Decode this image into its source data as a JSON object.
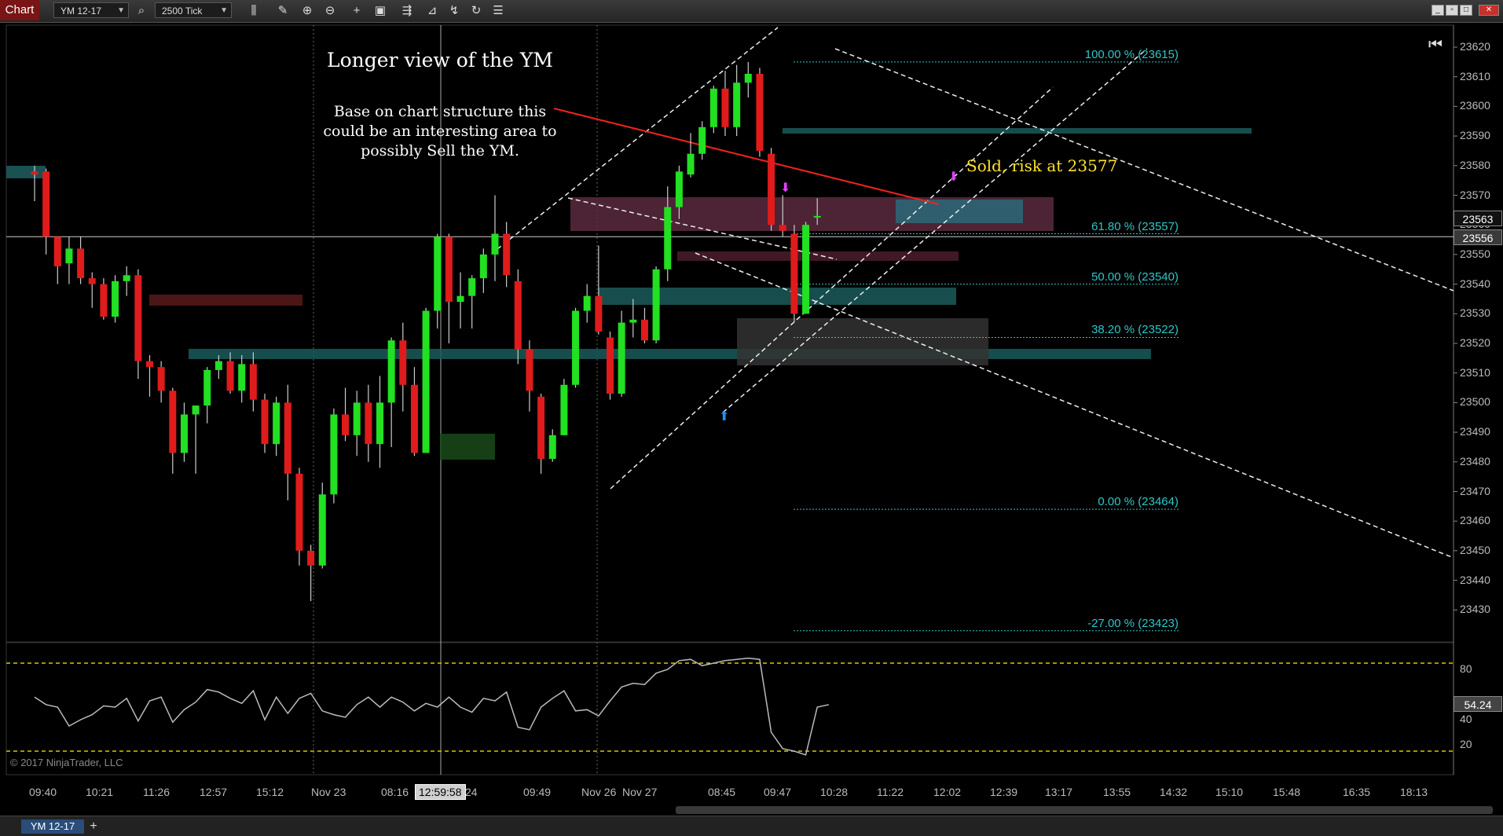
{
  "toolbar": {
    "chart_tab": "Chart",
    "instrument": "YM 12-17",
    "interval": "2500 Tick",
    "icons": [
      "search-icon",
      "bars-icon",
      "pencil-icon",
      "zoom-in-icon",
      "zoom-out-icon",
      "crosshair-icon",
      "data-box-icon",
      "strategy-icon",
      "indicator-icon",
      "drawing-tools-icon",
      "refresh-icon",
      "properties-icon"
    ]
  },
  "annotations": {
    "title": "Longer view of the YM",
    "body_line1": "Base on chart structure this",
    "body_line2": "could be an interesting area to",
    "body_line3": "possibly Sell the YM.",
    "sold": "Sold, risk at 23577"
  },
  "price_axis": {
    "ticks": [
      "23620",
      "23610",
      "23600",
      "23590",
      "23580",
      "23570",
      "23560",
      "23550",
      "23540",
      "23530",
      "23520",
      "23510",
      "23500",
      "23490",
      "23480",
      "23470",
      "23460",
      "23450",
      "23440",
      "23430"
    ],
    "tag_upper": "23563",
    "tag_last": "23556"
  },
  "fib_levels": [
    {
      "label": "100.00 % (23615)",
      "price": 23615
    },
    {
      "label": "61.80 % (23557)",
      "price": 23557
    },
    {
      "label": "50.00 % (23540)",
      "price": 23540
    },
    {
      "label": "38.20 % (23522)",
      "price": 23522
    },
    {
      "label": "0.00 % (23464)",
      "price": 23464
    },
    {
      "label": "-27.00 % (23423)",
      "price": 23423
    }
  ],
  "time_axis": {
    "labels": [
      "09:40",
      "10:21",
      "11:26",
      "12:57",
      "15:12",
      "Nov 23",
      "08:16",
      "24",
      "09:49",
      "Nov 26",
      "Nov 27",
      "08:45",
      "09:47",
      "10:28",
      "11:22",
      "12:02",
      "12:39",
      "13:17",
      "13:55",
      "14:32",
      "15:10",
      "15:48",
      "16:35",
      "18:13"
    ],
    "cursor_time": "12:59:58"
  },
  "indicator": {
    "ticks": [
      "80",
      "40",
      "20"
    ],
    "value_tag": "54.24",
    "upper_band": 85,
    "lower_band": 15
  },
  "copyright": "© 2017 NinjaTrader, LLC",
  "bottom_tab": "YM 12-17",
  "colors": {
    "up": "#22e022",
    "down": "#e01b1b",
    "fib": "#2fc6c6",
    "annotation_yellow": "#ffe22c",
    "band_yellow": "#d8c800"
  },
  "candles": [
    {
      "o": 23578,
      "h": 23580,
      "l": 23568,
      "c": 23577
    },
    {
      "o": 23578,
      "h": 23579,
      "l": 23550,
      "c": 23556
    },
    {
      "o": 23556,
      "h": 23555,
      "l": 23540,
      "c": 23546
    },
    {
      "o": 23547,
      "h": 23556,
      "l": 23540,
      "c": 23552
    },
    {
      "o": 23552,
      "h": 23556,
      "l": 23540,
      "c": 23542
    },
    {
      "o": 23542,
      "h": 23544,
      "l": 23532,
      "c": 23540
    },
    {
      "o": 23540,
      "h": 23542,
      "l": 23528,
      "c": 23529
    },
    {
      "o": 23529,
      "h": 23543,
      "l": 23527,
      "c": 23541
    },
    {
      "o": 23541,
      "h": 23546,
      "l": 23536,
      "c": 23543
    },
    {
      "o": 23543,
      "h": 23545,
      "l": 23508,
      "c": 23514
    },
    {
      "o": 23514,
      "h": 23516,
      "l": 23502,
      "c": 23512
    },
    {
      "o": 23512,
      "h": 23514,
      "l": 23500,
      "c": 23504
    },
    {
      "o": 23504,
      "h": 23505,
      "l": 23476,
      "c": 23483
    },
    {
      "o": 23483,
      "h": 23500,
      "l": 23480,
      "c": 23496
    },
    {
      "o": 23496,
      "h": 23499,
      "l": 23476,
      "c": 23499
    },
    {
      "o": 23499,
      "h": 23512,
      "l": 23493,
      "c": 23511
    },
    {
      "o": 23511,
      "h": 23516,
      "l": 23508,
      "c": 23514
    },
    {
      "o": 23514,
      "h": 23517,
      "l": 23503,
      "c": 23504
    },
    {
      "o": 23504,
      "h": 23516,
      "l": 23500,
      "c": 23513
    },
    {
      "o": 23513,
      "h": 23517,
      "l": 23497,
      "c": 23501
    },
    {
      "o": 23501,
      "h": 23503,
      "l": 23483,
      "c": 23486
    },
    {
      "o": 23486,
      "h": 23502,
      "l": 23482,
      "c": 23500
    },
    {
      "o": 23500,
      "h": 23506,
      "l": 23467,
      "c": 23476
    },
    {
      "o": 23476,
      "h": 23478,
      "l": 23445,
      "c": 23450
    },
    {
      "o": 23450,
      "h": 23452,
      "l": 23433,
      "c": 23445
    },
    {
      "o": 23445,
      "h": 23473,
      "l": 23444,
      "c": 23469
    },
    {
      "o": 23469,
      "h": 23498,
      "l": 23466,
      "c": 23496
    },
    {
      "o": 23496,
      "h": 23505,
      "l": 23487,
      "c": 23489
    },
    {
      "o": 23489,
      "h": 23504,
      "l": 23482,
      "c": 23500
    },
    {
      "o": 23500,
      "h": 23506,
      "l": 23480,
      "c": 23486
    },
    {
      "o": 23486,
      "h": 23509,
      "l": 23478,
      "c": 23500
    },
    {
      "o": 23500,
      "h": 23522,
      "l": 23485,
      "c": 23521
    },
    {
      "o": 23521,
      "h": 23527,
      "l": 23497,
      "c": 23506
    },
    {
      "o": 23506,
      "h": 23512,
      "l": 23482,
      "c": 23483
    },
    {
      "o": 23483,
      "h": 23532,
      "l": 23483,
      "c": 23531
    },
    {
      "o": 23531,
      "h": 23557,
      "l": 23525,
      "c": 23556
    },
    {
      "o": 23556,
      "h": 23557,
      "l": 23520,
      "c": 23534
    },
    {
      "o": 23534,
      "h": 23544,
      "l": 23525,
      "c": 23536
    },
    {
      "o": 23536,
      "h": 23543,
      "l": 23525,
      "c": 23542
    },
    {
      "o": 23542,
      "h": 23552,
      "l": 23537,
      "c": 23550
    },
    {
      "o": 23550,
      "h": 23570,
      "l": 23541,
      "c": 23557
    },
    {
      "o": 23557,
      "h": 23561,
      "l": 23539,
      "c": 23543
    },
    {
      "o": 23541,
      "h": 23545,
      "l": 23513,
      "c": 23518
    },
    {
      "o": 23518,
      "h": 23521,
      "l": 23497,
      "c": 23504
    },
    {
      "o": 23502,
      "h": 23503,
      "l": 23476,
      "c": 23481
    },
    {
      "o": 23481,
      "h": 23491,
      "l": 23480,
      "c": 23489
    },
    {
      "o": 23489,
      "h": 23508,
      "l": 23489,
      "c": 23506
    },
    {
      "o": 23506,
      "h": 23532,
      "l": 23505,
      "c": 23531
    },
    {
      "o": 23531,
      "h": 23540,
      "l": 23527,
      "c": 23536
    },
    {
      "o": 23536,
      "h": 23553,
      "l": 23523,
      "c": 23524
    },
    {
      "o": 23522,
      "h": 23524,
      "l": 23501,
      "c": 23503
    },
    {
      "o": 23503,
      "h": 23531,
      "l": 23502,
      "c": 23527
    },
    {
      "o": 23527,
      "h": 23535,
      "l": 23522,
      "c": 23528
    },
    {
      "o": 23528,
      "h": 23532,
      "l": 23520,
      "c": 23521
    },
    {
      "o": 23521,
      "h": 23546,
      "l": 23520,
      "c": 23545
    },
    {
      "o": 23545,
      "h": 23573,
      "l": 23541,
      "c": 23566
    },
    {
      "o": 23566,
      "h": 23580,
      "l": 23562,
      "c": 23578
    },
    {
      "o": 23577,
      "h": 23591,
      "l": 23576,
      "c": 23584
    },
    {
      "o": 23584,
      "h": 23595,
      "l": 23582,
      "c": 23593
    },
    {
      "o": 23593,
      "h": 23607,
      "l": 23591,
      "c": 23606
    },
    {
      "o": 23606,
      "h": 23612,
      "l": 23590,
      "c": 23593
    },
    {
      "o": 23593,
      "h": 23614,
      "l": 23590,
      "c": 23608
    },
    {
      "o": 23608,
      "h": 23615,
      "l": 23603,
      "c": 23611
    },
    {
      "o": 23611,
      "h": 23613,
      "l": 23583,
      "c": 23585
    },
    {
      "o": 23584,
      "h": 23586,
      "l": 23558,
      "c": 23560
    },
    {
      "o": 23560,
      "h": 23570,
      "l": 23556,
      "c": 23558
    },
    {
      "o": 23557,
      "h": 23560,
      "l": 23527,
      "c": 23530
    },
    {
      "o": 23530,
      "h": 23561,
      "l": 23530,
      "c": 23560
    },
    {
      "o": 23563,
      "h": 23569,
      "l": 23560,
      "c": 23563
    }
  ],
  "oscillator": [
    58,
    52,
    50,
    35,
    40,
    44,
    51,
    50,
    57,
    39,
    55,
    58,
    38,
    48,
    54,
    64,
    62,
    57,
    53,
    63,
    40,
    58,
    45,
    57,
    61,
    47,
    44,
    42,
    52,
    58,
    50,
    58,
    54,
    47,
    53,
    50,
    58,
    50,
    46,
    57,
    55,
    62,
    34,
    32,
    50,
    57,
    63,
    47,
    48,
    43,
    55,
    66,
    69,
    68,
    77,
    80,
    87,
    88,
    83,
    85,
    87,
    88,
    89,
    88,
    30,
    17,
    15,
    12,
    50,
    52
  ]
}
